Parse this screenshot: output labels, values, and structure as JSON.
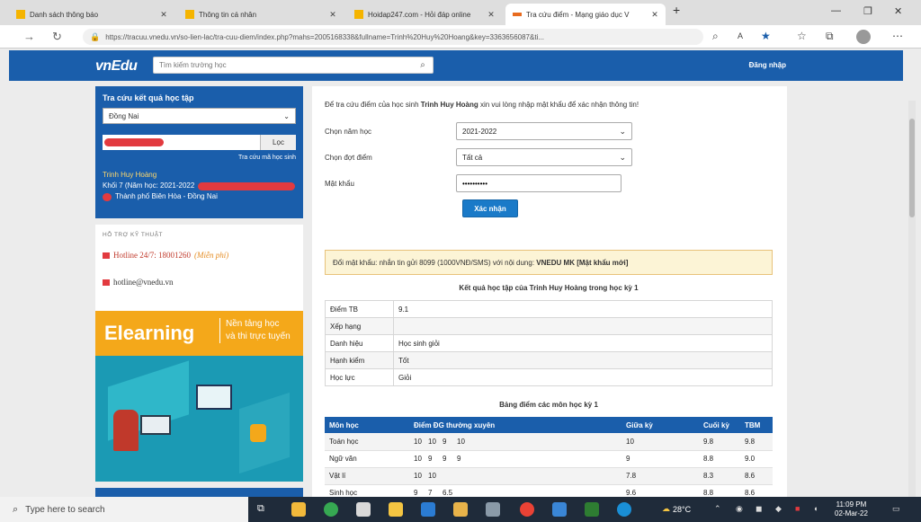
{
  "browser": {
    "tabs": [
      {
        "label": "Danh sách thông báo",
        "color": "#f5b400",
        "active": false
      },
      {
        "label": "Thông tin cá nhân",
        "color": "#f5b400",
        "active": false
      },
      {
        "label": "Hoidap247.com - Hỏi đáp online",
        "color": "#f5b400",
        "active": false
      },
      {
        "label": "Tra cứu điểm - Mạng giáo dục V",
        "color": "#e86b1f",
        "active": true
      }
    ],
    "url": "https://tracuu.vnedu.vn/so-lien-lac/tra-cuu-diem/index.php?mahs=2005168338&fullname=Trinh%20Huy%20Hoang&key=3363656087&ti..."
  },
  "site": {
    "logo_main": "vnEdu",
    "logo_suffix": "",
    "search_placeholder": "Tìm kiếm trường học",
    "login_label": "Đăng nhập"
  },
  "lookup": {
    "title": "Tra cứu kết quả học tập",
    "province": "Đồng Nai",
    "lookup_button": "Lọc",
    "link": "Tra cứu mã học sinh",
    "student_name": "Trinh Huy Hoàng",
    "grade_line": "Khối 7 (Năm học: 2021-2022",
    "location": "Thành phố Biên Hòa - Đồng Nai"
  },
  "support": {
    "title": "HỖ TRỢ KỸ THUẬT",
    "hotline": "Hotline 24/7: 18001260",
    "hotline_free": "(Miễn phí)",
    "email": "hotline@vnedu.vn"
  },
  "banner": {
    "word": "Elearning",
    "tag_line1": "Nền tảng học",
    "tag_line2": "và thi trực tuyến"
  },
  "form": {
    "intro_pre": "Để tra cứu điểm của học sinh",
    "intro_name": "Trinh Huy Hoàng",
    "intro_post": "xin vui lòng nhập mật khẩu để xác nhận thông tin!",
    "year_label": "Chọn năm học",
    "year_value": "2021-2022",
    "term_label": "Chọn đợt điểm",
    "term_value": "Tất cả",
    "password_label": "Mật khẩu",
    "password_value": "••••••••••",
    "confirm_label": "Xác nhận"
  },
  "notice": {
    "pre": "Đổi mật khẩu: nhắn tin gửi 8099 (1000VNĐ/SMS) với nội dung:",
    "cmd": "VNEDU MK [Mật khẩu mới]"
  },
  "summary": {
    "title": "Kết quả học tập của Trinh Huy Hoàng trong học kỳ 1",
    "rows": [
      {
        "k": "Điểm TB",
        "v": "9.1"
      },
      {
        "k": "Xếp hạng",
        "v": ""
      },
      {
        "k": "Danh hiệu",
        "v": "Học sinh giỏi"
      },
      {
        "k": "Hạnh kiểm",
        "v": "Tốt"
      },
      {
        "k": "Học lực",
        "v": "Giỏi"
      }
    ]
  },
  "grades": {
    "title": "Bảng điểm các môn học kỳ 1",
    "headers": [
      "Môn học",
      "Điểm ĐG thường xuyên",
      "Giữa kỳ",
      "Cuối kỳ",
      "TBM"
    ],
    "rows": [
      {
        "subject": "Toán học",
        "scores": [
          "10",
          "10",
          "9",
          "10"
        ],
        "mid": "10",
        "final": "9.8",
        "avg": "9.8"
      },
      {
        "subject": "Ngữ văn",
        "scores": [
          "10",
          "9",
          "9",
          "9"
        ],
        "mid": "9",
        "final": "8.8",
        "avg": "9.0"
      },
      {
        "subject": "Vật lí",
        "scores": [
          "10",
          "10"
        ],
        "mid": "7.8",
        "final": "8.3",
        "avg": "8.6"
      },
      {
        "subject": "Sinh học",
        "scores": [
          "9",
          "7",
          "6.5"
        ],
        "mid": "9.6",
        "final": "8.8",
        "avg": "8.6"
      }
    ]
  },
  "taskbar": {
    "search_placeholder": "Type here to search",
    "temperature": "28°C",
    "time": "11:09 PM",
    "date": "02-Mar-22"
  }
}
